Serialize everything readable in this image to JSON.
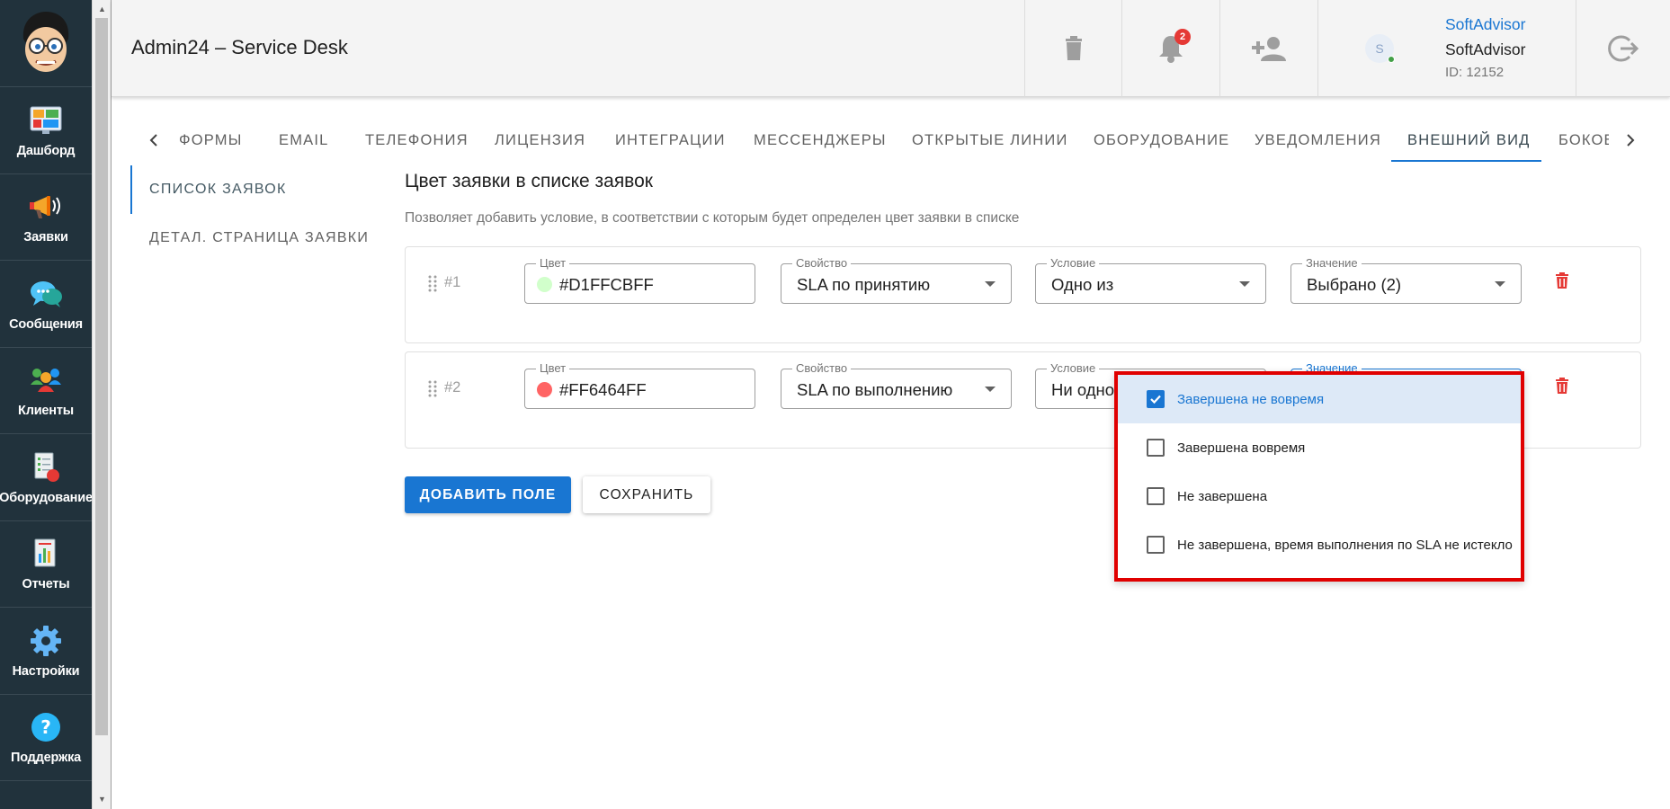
{
  "sidebar": {
    "items": [
      {
        "label": "Дашборд",
        "icon": "dashboard-icon"
      },
      {
        "label": "Заявки",
        "icon": "megaphone-icon"
      },
      {
        "label": "Сообщения",
        "icon": "chat-bubbles-icon"
      },
      {
        "label": "Клиенты",
        "icon": "clients-icon"
      },
      {
        "label": "Оборудование",
        "icon": "equipment-icon"
      },
      {
        "label": "Отчеты",
        "icon": "reports-icon"
      },
      {
        "label": "Настройки",
        "icon": "gear-icon"
      },
      {
        "label": "Поддержка",
        "icon": "help-icon"
      }
    ]
  },
  "header": {
    "title": "Admin24 – Service Desk",
    "notifications_count": "2",
    "user": {
      "avatar_letter": "S",
      "link_name": "SoftAdvisor",
      "name": "SoftAdvisor",
      "id": "ID: 12152"
    }
  },
  "tabs": {
    "items": [
      "ФОРМЫ",
      "EMAIL",
      "ТЕЛЕФОНИЯ",
      "ЛИЦЕНЗИЯ",
      "ИНТЕГРАЦИИ",
      "МЕССЕНДЖЕРЫ",
      "ОТКРЫТЫЕ ЛИНИИ",
      "ОБОРУДОВАНИЕ",
      "УВЕДОМЛЕНИЯ",
      "ВНЕШНИЙ ВИД",
      "БОКОВОЕ МЕНЮ"
    ],
    "active": "ВНЕШНИЙ ВИД"
  },
  "subnav": {
    "items": [
      "СПИСОК ЗАЯВОК",
      "ДЕТАЛ. СТРАНИЦА ЗАЯВКИ"
    ]
  },
  "main": {
    "title": "Цвет заявки в списке заявок",
    "description": "Позволяет добавить условие, в соответствии с которым будет определен цвет заявки в списке",
    "rules": [
      {
        "number": "#1",
        "color_label": "Цвет",
        "color_value": "#D1FFCBFF",
        "color_swatch": "#D1FFCB",
        "property_label": "Свойство",
        "property_value": "SLA по принятию",
        "condition_label": "Условие",
        "condition_value": "Одно из",
        "value_label": "Значение",
        "value_value": "Выбрано (2)"
      },
      {
        "number": "#2",
        "color_label": "Цвет",
        "color_value": "#FF6464FF",
        "color_swatch": "#FF6464",
        "property_label": "Свойство",
        "property_value": "SLA по выполнению",
        "condition_label": "Условие",
        "condition_value": "Ни одно",
        "value_label": "Значение"
      }
    ],
    "add_button": "ДОБАВИТЬ ПОЛЕ",
    "save_button": "СОХРАНИТЬ"
  },
  "dropdown": {
    "options": [
      {
        "label": "Завершена не вовремя",
        "checked": true
      },
      {
        "label": "Завершена вовремя",
        "checked": false
      },
      {
        "label": "Не завершена",
        "checked": false
      },
      {
        "label": "Не завершена, время выполнения по SLA не истекло",
        "checked": false
      }
    ]
  },
  "colors": {
    "sidebar_bg": "#21323C",
    "accent": "#1976D2",
    "danger": "#E53935",
    "highlight_border": "#E00000"
  }
}
